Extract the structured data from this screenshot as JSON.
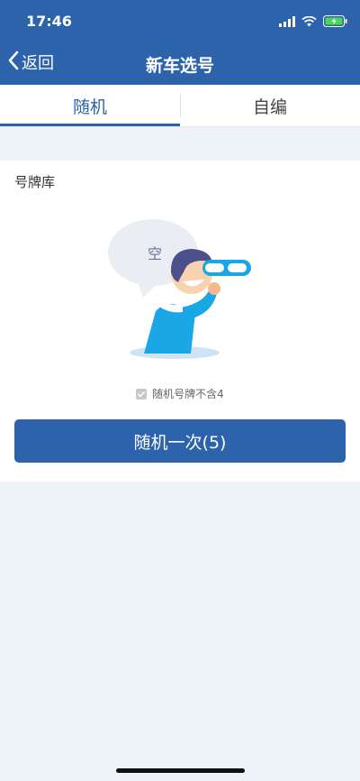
{
  "status_bar": {
    "time": "17:46",
    "icons": [
      "signal-icon",
      "wifi-icon",
      "battery-charging-icon"
    ]
  },
  "nav": {
    "back_label": "返回",
    "title": "新车选号"
  },
  "tabs": [
    {
      "label": "随机",
      "selected": true
    },
    {
      "label": "自编",
      "selected": false
    }
  ],
  "plate_pool": {
    "title": "号牌库",
    "empty_text": "空"
  },
  "option": {
    "label": "随机号牌不含4",
    "checked": true
  },
  "action_button": {
    "label": "随机一次(5)"
  },
  "colors": {
    "primary": "#2c63aa",
    "background": "#eef3f7",
    "illustration_blue": "#1aa7e6"
  }
}
